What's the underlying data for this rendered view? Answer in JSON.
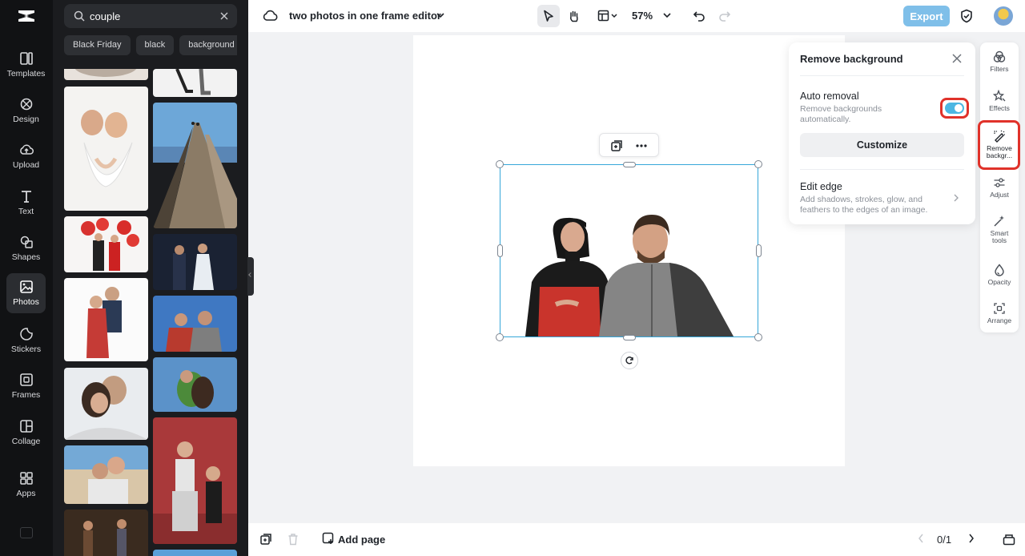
{
  "rail": {
    "items": [
      {
        "label": "Templates",
        "icon": "templates-icon"
      },
      {
        "label": "Design",
        "icon": "design-icon"
      },
      {
        "label": "Upload",
        "icon": "upload-icon"
      },
      {
        "label": "Text",
        "icon": "text-icon"
      },
      {
        "label": "Shapes",
        "icon": "shapes-icon"
      },
      {
        "label": "Photos",
        "icon": "photos-icon",
        "active": true
      },
      {
        "label": "Stickers",
        "icon": "stickers-icon"
      },
      {
        "label": "Frames",
        "icon": "frames-icon"
      },
      {
        "label": "Collage",
        "icon": "collage-icon"
      },
      {
        "label": "Apps",
        "icon": "apps-icon"
      }
    ]
  },
  "panel": {
    "search_value": "couple",
    "chips": [
      "Black Friday",
      "black",
      "background"
    ]
  },
  "topbar": {
    "title": "two photos in one frame editor",
    "zoom": "57%",
    "export_label": "Export"
  },
  "popover": {
    "title": "Remove background",
    "auto_title": "Auto removal",
    "auto_desc": "Remove backgrounds automatically.",
    "auto_enabled": true,
    "customize_label": "Customize",
    "edge_title": "Edit edge",
    "edge_desc": "Add shadows, strokes, glow, and feathers to the edges of an image."
  },
  "props": {
    "items": [
      {
        "label": "Filters",
        "icon": "filters-icon"
      },
      {
        "label": "Effects",
        "icon": "effects-icon"
      },
      {
        "label": "Remove backgr...",
        "icon": "remove-background-icon",
        "highlighted": true
      },
      {
        "label": "Adjust",
        "icon": "adjust-icon"
      },
      {
        "label": "Smart tools",
        "icon": "smart-tools-icon"
      },
      {
        "label": "Opacity",
        "icon": "opacity-icon"
      },
      {
        "label": "Arrange",
        "icon": "arrange-icon"
      }
    ]
  },
  "bottombar": {
    "add_page_label": "Add page",
    "page_indicator": "0/1"
  },
  "colors": {
    "accent": "#36a7d9",
    "highlight": "#e0322a",
    "export": "#7fbfe9",
    "rail_bg": "#111214"
  }
}
